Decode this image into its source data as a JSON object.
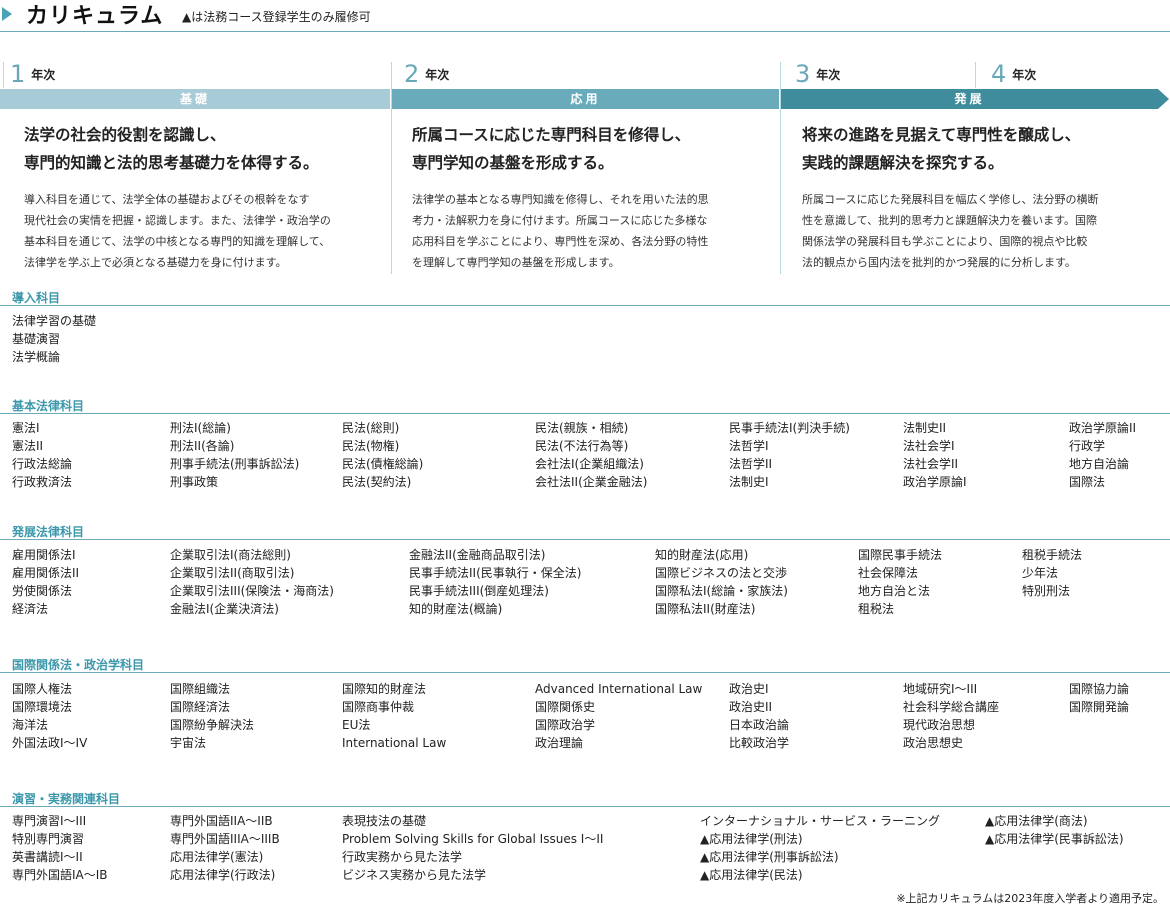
{
  "header": {
    "title": "カリキュラム",
    "note": "▲は法務コース登録学生のみ履修可"
  },
  "years": {
    "y1_num": "1",
    "y2_num": "2",
    "y3_num": "3",
    "y4_num": "4",
    "label": "年次"
  },
  "stages": {
    "kiso": "基礎",
    "ouyo": "応用",
    "hatten": "発展"
  },
  "columns": {
    "c1": {
      "head1": "法学の社会的役割を認識し、",
      "head2": "専門的知識と法的思考基礎力を体得する。",
      "desc": [
        "導入科目を通じて、法学全体の基礎およびその根幹をなす",
        "現代社会の実情を把握・認識します。また、法律学・政治学の",
        "基本科目を通じて、法学の中核となる専門的知識を理解して、",
        "法律学を学ぶ上で必須となる基礎力を身に付けます。"
      ]
    },
    "c2": {
      "head1": "所属コースに応じた専門科目を修得し、",
      "head2": "専門学知の基盤を形成する。",
      "desc": [
        "法律学の基本となる専門知識を修得し、それを用いた法的思",
        "考力・法解釈力を身に付けます。所属コースに応じた多様な",
        "応用科目を学ぶことにより、専門性を深め、各法分野の特性",
        "を理解して専門学知の基盤を形成します。"
      ]
    },
    "c3": {
      "head1": "将来の進路を見据えて専門性を醸成し、",
      "head2": "実践的課題解決を探究する。",
      "desc": [
        "所属コースに応じた発展科目を幅広く学修し、法分野の横断",
        "性を意識して、批判的思考力と課題解決力を養います。国際",
        "関係法学の発展科目も学ぶことにより、国際的視点や比較",
        "法的観点から国内法を批判的かつ発展的に分析します。"
      ]
    }
  },
  "sections": {
    "s1": {
      "title": "導入科目",
      "cols": [
        [
          "法律学習の基礎",
          "基礎演習",
          "法学概論"
        ]
      ]
    },
    "s2": {
      "title": "基本法律科目",
      "cols": [
        [
          "憲法I",
          "憲法II",
          "行政法総論",
          "行政救済法"
        ],
        [
          "刑法I(総論)",
          "刑法II(各論)",
          "刑事手続法(刑事訴訟法)",
          "刑事政策"
        ],
        [
          "民法(総則)",
          "民法(物権)",
          "民法(債権総論)",
          "民法(契約法)"
        ],
        [
          "民法(親族・相続)",
          "民法(不法行為等)",
          "会社法I(企業組織法)",
          "会社法II(企業金融法)"
        ],
        [
          "民事手続法I(判決手続)",
          "法哲学I",
          "法哲学II",
          "法制史I"
        ],
        [
          "法制史II",
          "法社会学I",
          "法社会学II",
          "政治学原論I"
        ],
        [
          "政治学原論II",
          "行政学",
          "地方自治論",
          "国際法"
        ]
      ]
    },
    "s3": {
      "title": "発展法律科目",
      "cols": [
        [
          "雇用関係法I",
          "雇用関係法II",
          "労使関係法",
          "経済法"
        ],
        [
          "企業取引法I(商法総則)",
          "企業取引法II(商取引法)",
          "企業取引法III(保険法・海商法)",
          "金融法I(企業決済法)"
        ],
        [
          "金融法II(金融商品取引法)",
          "民事手続法II(民事執行・保全法)",
          "民事手続法III(倒産処理法)",
          "知的財産法(概論)"
        ],
        [
          "知的財産法(応用)",
          "国際ビジネスの法と交渉",
          "国際私法I(総論・家族法)",
          "国際私法II(財産法)"
        ],
        [
          "国際民事手続法",
          "社会保障法",
          "地方自治と法",
          "租税法"
        ],
        [
          "租税手続法",
          "少年法",
          "特別刑法"
        ]
      ]
    },
    "s4": {
      "title": "国際関係法・政治学科目",
      "cols": [
        [
          "国際人権法",
          "国際環境法",
          "海洋法",
          "外国法政I〜IV"
        ],
        [
          "国際組織法",
          "国際経済法",
          "国際紛争解決法",
          "宇宙法"
        ],
        [
          "国際知的財産法",
          "国際商事仲裁",
          "EU法",
          "International Law"
        ],
        [
          "Advanced International Law",
          "国際関係史",
          "国際政治学",
          "政治理論"
        ],
        [
          "政治史I",
          "政治史II",
          "日本政治論",
          "比較政治学"
        ],
        [
          "地域研究I〜III",
          "社会科学総合講座",
          "現代政治思想",
          "政治思想史"
        ],
        [
          "国際協力論",
          "国際開発論"
        ]
      ]
    },
    "s5": {
      "title": "演習・実務関連科目",
      "cols": [
        [
          "専門演習I〜III",
          "特別専門演習",
          "英書講読I〜II",
          "専門外国語IA〜IB"
        ],
        [
          "専門外国語IIA〜IIB",
          "専門外国語IIIA〜IIIB",
          "応用法律学(憲法)",
          "応用法律学(行政法)"
        ],
        [
          "表現技法の基礎",
          "Problem Solving Skills for Global Issues I〜II",
          "行政実務から見た法学",
          "ビジネス実務から見た法学"
        ],
        [
          "インターナショナル・サービス・ラーニング",
          "▲応用法律学(刑法)",
          "▲応用法律学(刑事訴訟法)",
          "▲応用法律学(民法)"
        ],
        [
          "▲応用法律学(商法)",
          "▲応用法律学(民事訴訟法)"
        ]
      ]
    }
  },
  "footnote": "※上記カリキュラムは2023年度入学者より適用予定。"
}
